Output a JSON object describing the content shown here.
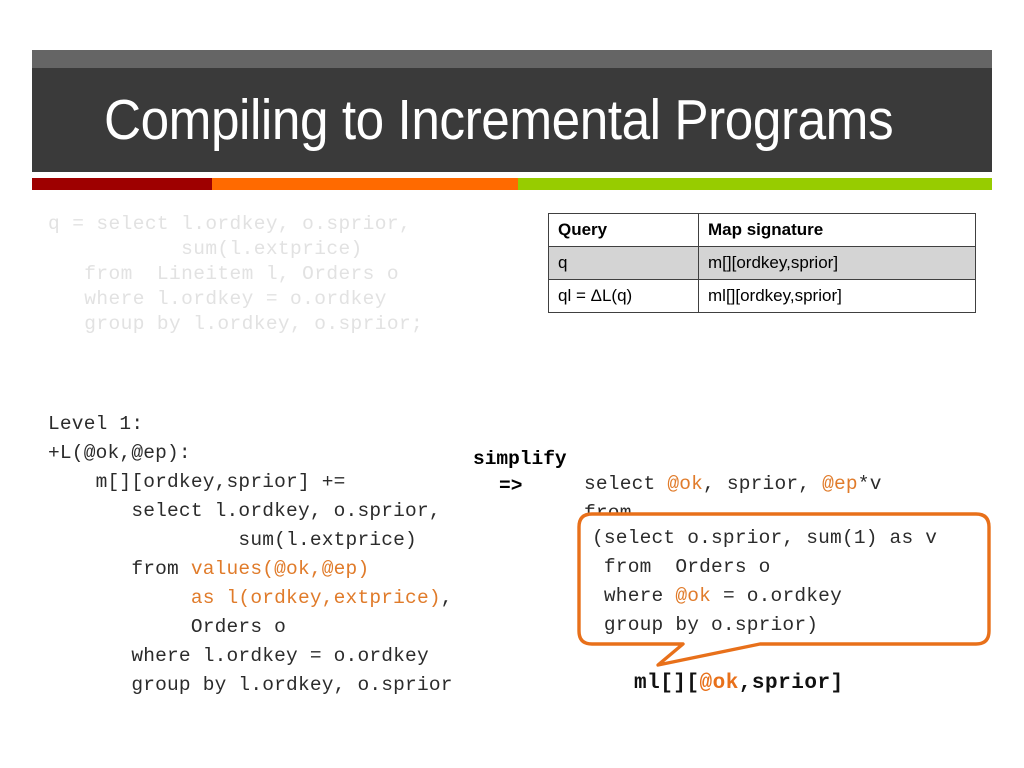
{
  "slide": {
    "title": "Compiling to Incremental Programs",
    "accent_colors": {
      "dark_bar": "#3a3a3a",
      "gray_bar": "#656565",
      "red": "#9e0000",
      "orange": "#ff6a00",
      "green": "#97cc00",
      "highlight_orange": "#e07b2a",
      "callout_border": "#e8701a"
    }
  },
  "faded_query": {
    "lines": [
      "q = select l.ordkey, o.sprior,",
      "           sum(l.extprice)",
      "   from  Lineitem l, Orders o",
      "   where l.ordkey = o.ordkey",
      "   group by l.ordkey, o.sprior;"
    ],
    "text": "q = select l.ordkey, o.sprior,\n           sum(l.extprice)\n   from  Lineitem l, Orders o\n   where l.ordkey = o.ordkey\n   group by l.ordkey, o.sprior;"
  },
  "signature_table": {
    "headers": [
      "Query",
      "Map signature"
    ],
    "rows": [
      {
        "query": "q",
        "signature": "m[][ordkey,sprior]",
        "shaded": true
      },
      {
        "query": "ql = ΔL(q)",
        "signature": "ml[][ordkey,sprior]",
        "shaded": false
      }
    ]
  },
  "level_code": {
    "line_level": "Level 1:",
    "line_delta": "+L(@ok,@ep):",
    "line_map": "    m[][ordkey,sprior] +=",
    "line_select": "       select l.ordkey, o.sprior,",
    "line_sum": "                sum(l.extprice)",
    "line_from_prefix": "       from ",
    "line_from_values": "values(@ok,@ep)",
    "line_as_indent": "            ",
    "line_as_values": "as l(ordkey,extprice)",
    "line_as_comma": ",",
    "line_orders": "            Orders o",
    "line_where": "       where l.ordkey = o.ordkey",
    "line_group": "       group by l.ordkey, o.sprior"
  },
  "simplify": {
    "label": "simplify",
    "arrow": "=>"
  },
  "result_code": {
    "select_prefix": "select ",
    "select_ok": "@ok",
    "select_mid": ", sprior, ",
    "select_ep": "@ep",
    "select_suffix": "*v",
    "from_line": "from"
  },
  "callout_code": {
    "line1": "(select o.sprior, sum(1) as v",
    "line2": " from  Orders o",
    "line3_prefix": " where ",
    "line3_ok": "@ok",
    "line3_suffix": " = o.ordkey",
    "line4": " group by o.sprior)"
  },
  "callout_label": {
    "prefix": "ml[][",
    "ok": "@ok",
    "suffix": ",sprior]"
  }
}
